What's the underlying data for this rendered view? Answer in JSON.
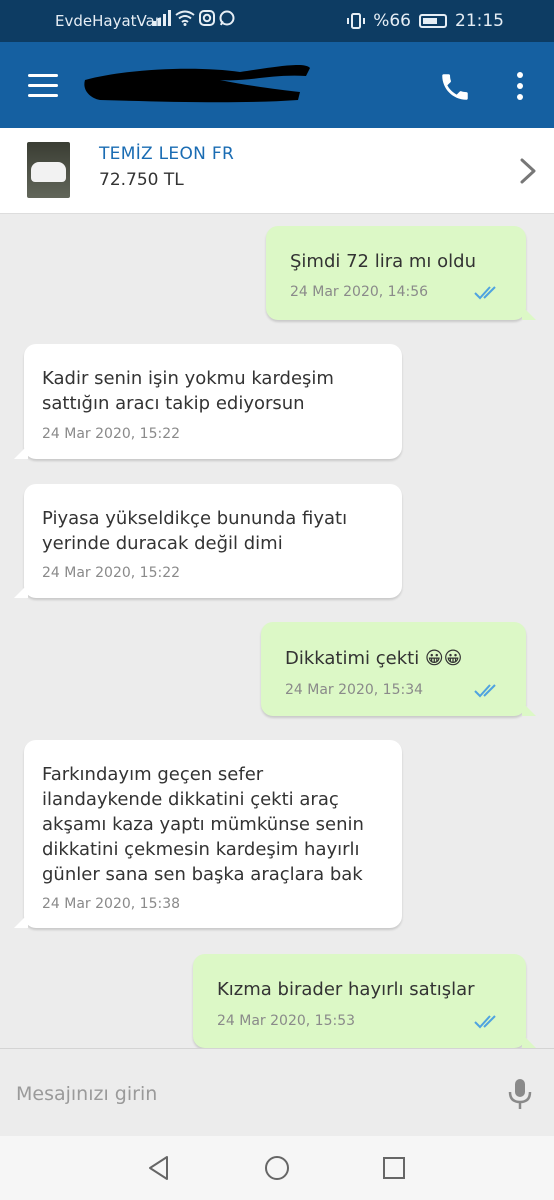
{
  "status_bar": {
    "carrier": "EvdeHayatVar",
    "battery": "%66",
    "time": "21:15"
  },
  "app_bar": {
    "icons": [
      "menu-icon",
      "phone-icon",
      "more-vertical-icon"
    ]
  },
  "listing": {
    "title": "TEMİZ LEON FR",
    "price": "72.750 TL"
  },
  "messages": [
    {
      "direction": "out",
      "text": "Şimdi 72 lira mı oldu",
      "time": "24 Mar 2020, 14:56",
      "read": true
    },
    {
      "direction": "in",
      "text": "Kadir senin işin yokmu kardeşim\nsattığın aracı takip ediyorsun",
      "time": "24 Mar 2020, 15:22"
    },
    {
      "direction": "in",
      "text": "Piyasa yükseldikçe bununda fiyatı\nyerinde duracak değil dimi",
      "time": "24 Mar 2020, 15:22"
    },
    {
      "direction": "out",
      "text": "Dikkatimi çekti 😀😀",
      "time": "24 Mar 2020, 15:34",
      "read": true
    },
    {
      "direction": "in",
      "text": "Farkındayım geçen sefer\nilandaykende dikkatini çekti araç\nakşamı kaza yaptı mümkünse senin\ndikkatini çekmesin kardeşim hayırlı\ngünler sana sen başka araçlara bak",
      "time": "24 Mar 2020, 15:38"
    },
    {
      "direction": "out",
      "text": "Kızma birader hayırlı satışlar",
      "time": "24 Mar 2020, 15:53",
      "read": true
    }
  ],
  "composer": {
    "placeholder": "Mesajınızı girin"
  },
  "colors": {
    "status_bar": "#0d3c63",
    "app_bar": "#1560a1",
    "outgoing_bubble": "#dcf8c6",
    "incoming_bubble": "#ffffff",
    "read_ticks": "#4fa3e0",
    "listing_title": "#1a6cb3"
  }
}
